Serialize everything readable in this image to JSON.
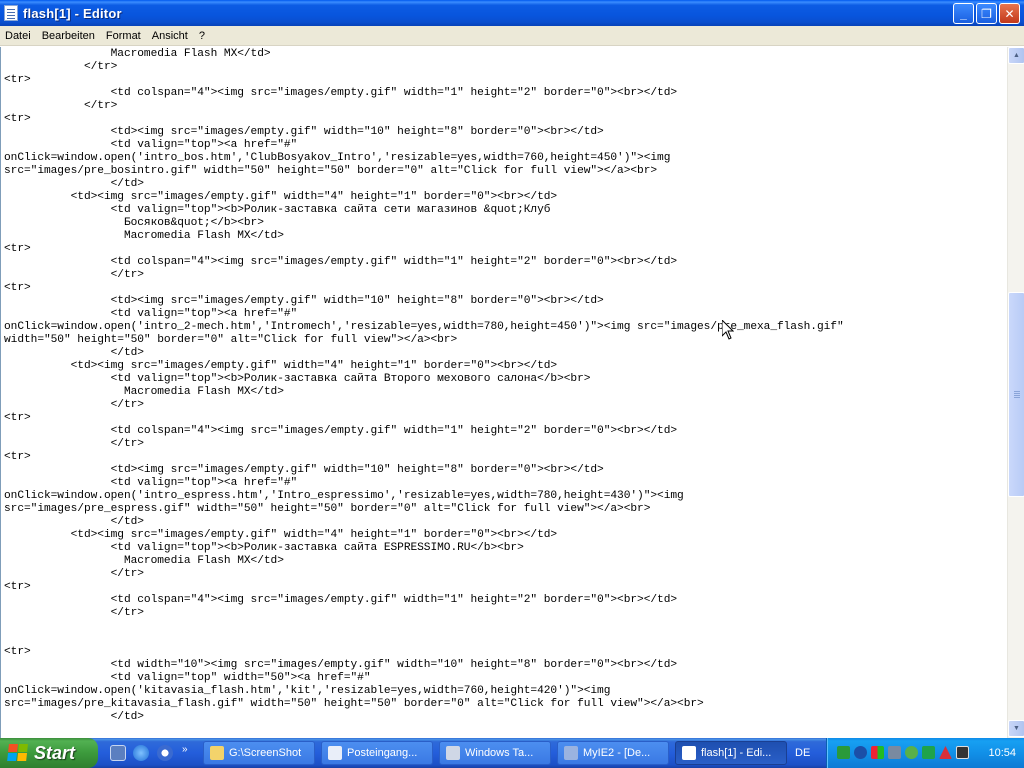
{
  "window": {
    "title": "flash[1] - Editor",
    "icon": "notepad-icon",
    "buttons": {
      "minimize": "_",
      "maximize": "❐",
      "close": "✕"
    }
  },
  "menu": {
    "items": [
      "Datei",
      "Bearbeiten",
      "Format",
      "Ansicht",
      "?"
    ]
  },
  "editor": {
    "lines": [
      "                Macromedia Flash MX</td>",
      "            </tr>",
      "<tr>",
      "                <td colspan=\"4\"><img src=\"images/empty.gif\" width=\"1\" height=\"2\" border=\"0\"><br></td>",
      "            </tr>",
      "<tr>",
      "                <td><img src=\"images/empty.gif\" width=\"10\" height=\"8\" border=\"0\"><br></td>",
      "                <td valign=\"top\"><a href=\"#\"",
      "onClick=window.open('intro_bos.htm','ClubBosyakov_Intro','resizable=yes,width=760,height=450')\"><img",
      "src=\"images/pre_bosintro.gif\" width=\"50\" height=\"50\" border=\"0\" alt=\"Click for full view\"></a><br>",
      "                </td>",
      "          <td><img src=\"images/empty.gif\" width=\"4\" height=\"1\" border=\"0\"><br></td>",
      "                <td valign=\"top\"><b>Ролик-заставка сайта сети магазинов &quot;Клуб",
      "                  Босяков&quot;</b><br>",
      "                  Macromedia Flash MX</td>",
      "<tr>",
      "                <td colspan=\"4\"><img src=\"images/empty.gif\" width=\"1\" height=\"2\" border=\"0\"><br></td>",
      "                </tr>",
      "<tr>",
      "                <td><img src=\"images/empty.gif\" width=\"10\" height=\"8\" border=\"0\"><br></td>",
      "                <td valign=\"top\"><a href=\"#\"",
      "onClick=window.open('intro_2-mech.htm','Intromech','resizable=yes,width=780,height=450')\"><img src=\"images/pre_mexa_flash.gif\"",
      "width=\"50\" height=\"50\" border=\"0\" alt=\"Click for full view\"></a><br>",
      "                </td>",
      "          <td><img src=\"images/empty.gif\" width=\"4\" height=\"1\" border=\"0\"><br></td>",
      "                <td valign=\"top\"><b>Ролик-заставка сайта Второго мехового салона</b><br>",
      "                  Macromedia Flash MX</td>",
      "                </tr>",
      "<tr>",
      "                <td colspan=\"4\"><img src=\"images/empty.gif\" width=\"1\" height=\"2\" border=\"0\"><br></td>",
      "                </tr>",
      "<tr>",
      "                <td><img src=\"images/empty.gif\" width=\"10\" height=\"8\" border=\"0\"><br></td>",
      "                <td valign=\"top\"><a href=\"#\"",
      "onClick=window.open('intro_espress.htm','Intro_espressimo','resizable=yes,width=780,height=430')\"><img",
      "src=\"images/pre_espress.gif\" width=\"50\" height=\"50\" border=\"0\" alt=\"Click for full view\"></a><br>",
      "                </td>",
      "          <td><img src=\"images/empty.gif\" width=\"4\" height=\"1\" border=\"0\"><br></td>",
      "                <td valign=\"top\"><b>Ролик-заставка сайта ESPRESSIMO.RU</b><br>",
      "                  Macromedia Flash MX</td>",
      "                </tr>",
      "<tr>",
      "                <td colspan=\"4\"><img src=\"images/empty.gif\" width=\"1\" height=\"2\" border=\"0\"><br></td>",
      "                </tr>",
      "",
      "",
      "<tr>",
      "                <td width=\"10\"><img src=\"images/empty.gif\" width=\"10\" height=\"8\" border=\"0\"><br></td>",
      "                <td valign=\"top\" width=\"50\"><a href=\"#\"",
      "onClick=window.open('kitavasia_flash.htm','kit','resizable=yes,width=760,height=420')\"><img",
      "src=\"images/pre_kitavasia_flash.gif\" width=\"50\" height=\"50\" border=\"0\" alt=\"Click for full view\"></a><br>",
      "                </td>"
    ]
  },
  "scrollbar": {
    "up": "▲",
    "down": "▼"
  },
  "taskbar": {
    "start_label": "Start",
    "tasks": [
      {
        "label": "G:\\ScreenShot",
        "icon": "folder-icon",
        "color": "#f3d36b"
      },
      {
        "label": "Posteingang...",
        "icon": "mail-icon",
        "color": "#e9eef9"
      },
      {
        "label": "Windows Ta...",
        "icon": "task-manager-icon",
        "color": "#cfd7e6"
      },
      {
        "label": "MyIE2 - [De...",
        "icon": "browser-icon",
        "color": "#9ab3e0"
      },
      {
        "label": "flash[1] - Edi...",
        "icon": "notepad-icon",
        "color": "#ffffff"
      }
    ],
    "language": "DE",
    "clock": "10:54"
  }
}
